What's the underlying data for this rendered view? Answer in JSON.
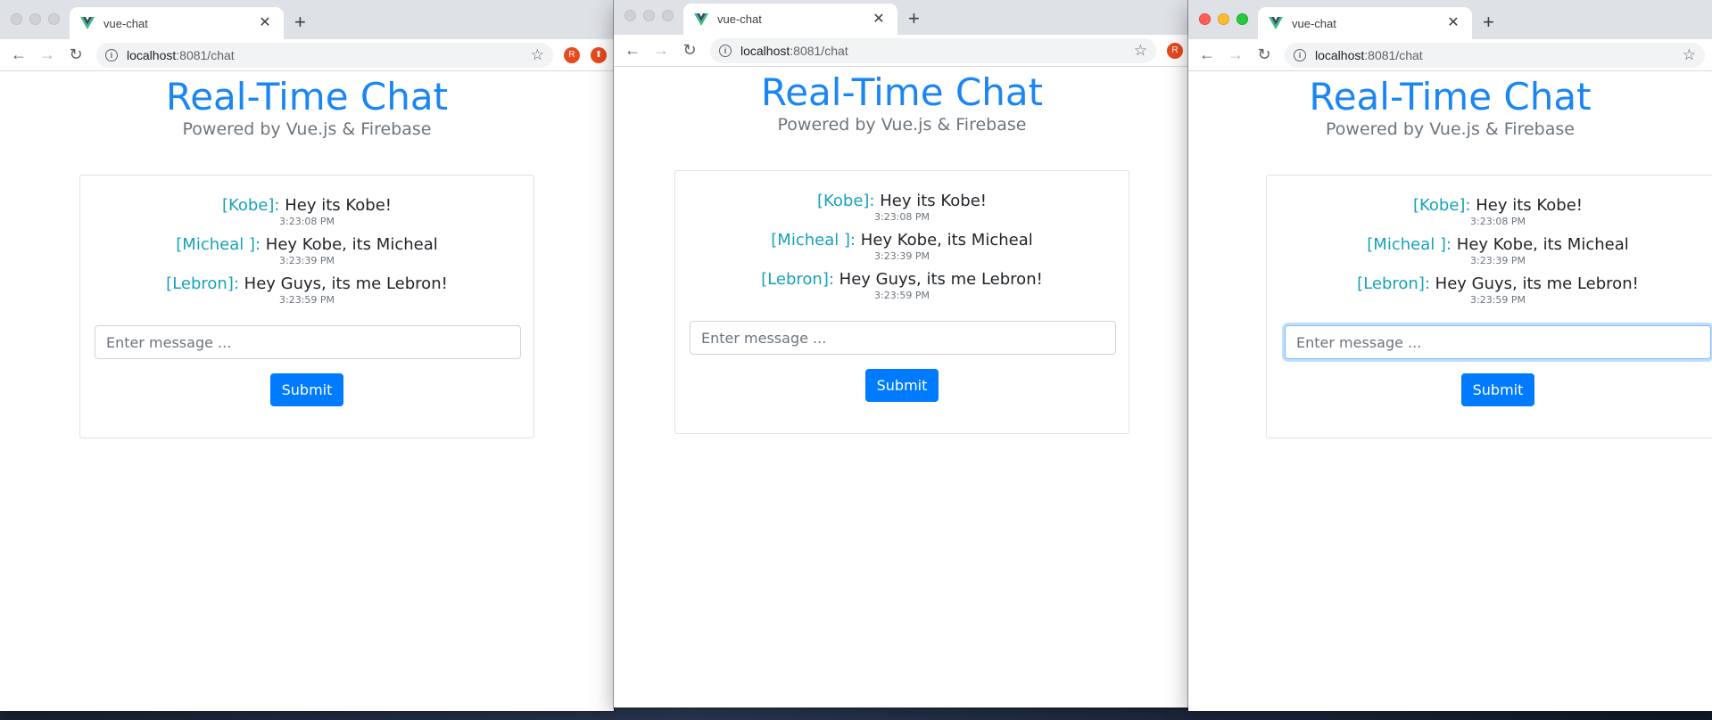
{
  "windows": [
    {
      "tab_title": "vue-chat",
      "url_host": "localhost",
      "url_path": ":8081/chat",
      "extensions": [
        "R",
        "⬆"
      ],
      "input_focused": false
    },
    {
      "tab_title": "vue-chat",
      "url_host": "localhost",
      "url_path": ":8081/chat",
      "extensions": [
        "R"
      ],
      "input_focused": false
    },
    {
      "tab_title": "vue-chat",
      "url_host": "localhost",
      "url_path": ":8081/chat",
      "extensions": [],
      "input_focused": true
    }
  ],
  "page": {
    "title": "Real-Time Chat",
    "subtitle": "Powered by Vue.js & Firebase",
    "messages": [
      {
        "user": "[Kobe]:",
        "text": "Hey its Kobe!",
        "time": "3:23:08 PM"
      },
      {
        "user": "[Micheal ]:",
        "text": "Hey Kobe, its Micheal",
        "time": "3:23:39 PM"
      },
      {
        "user": "[Lebron]:",
        "text": "Hey Guys, its me Lebron!",
        "time": "3:23:59 PM"
      }
    ],
    "input_placeholder": "Enter message ...",
    "submit_label": "Submit"
  },
  "colors": {
    "title": "#1a86f3",
    "username": "#17a2b8",
    "submit_button": "#007bff",
    "tab_strip": "#dee1e6"
  },
  "icons": [
    "vue-favicon-icon",
    "close-icon",
    "plus-icon",
    "back-arrow-icon",
    "forward-arrow-icon",
    "reload-icon",
    "info-icon",
    "star-icon",
    "extension-icon"
  ]
}
